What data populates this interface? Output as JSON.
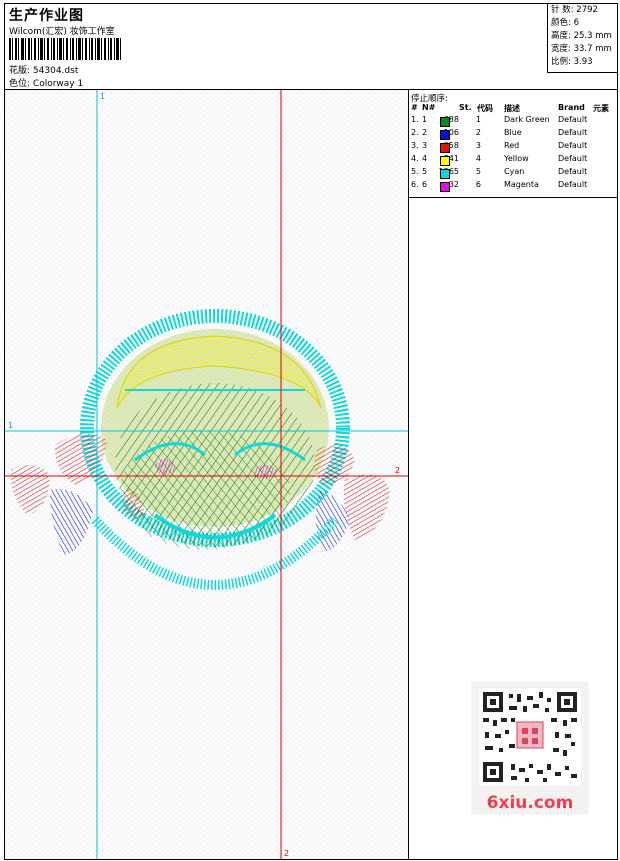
{
  "header": {
    "title": "生产作业图",
    "company": "Wilcom(汇宏) 妆饰工作室",
    "design_label": "花版:",
    "design_value": "54304.dst",
    "colorway_label": "色位:",
    "colorway_value": "Colorway 1"
  },
  "stats": [
    {
      "label": "针 数:",
      "value": "2792"
    },
    {
      "label": "颜色:",
      "value": "6"
    },
    {
      "label": "高度:",
      "value": "25.3 mm"
    },
    {
      "label": "宽度:",
      "value": "33.7 mm"
    },
    {
      "label": "比例:",
      "value": "3.93"
    }
  ],
  "canvas": {
    "guide_h_label_left": "1",
    "guide_h_label_right": "2",
    "guide_v_label_top": "1",
    "guide_v_label_bottom": "2",
    "colors": {
      "cyan_guide": "#00c8d8",
      "red_guide": "#e00000"
    }
  },
  "stop_sequence": {
    "title": "停止顺序:",
    "headers": {
      "num": "#",
      "no": "N#",
      "st": "St.",
      "code": "代码",
      "desc": "描述",
      "brand": "Brand",
      "elem": "元素"
    },
    "rows": [
      {
        "num": "1.",
        "no": "1",
        "color": "#0a8a1e",
        "st": "688",
        "code": "1",
        "desc": "Dark Green",
        "brand": "Default"
      },
      {
        "num": "2.",
        "no": "2",
        "color": "#0014dc",
        "st": "106",
        "code": "2",
        "desc": "Blue",
        "brand": "Default"
      },
      {
        "num": "3.",
        "no": "3",
        "color": "#e01010",
        "st": "358",
        "code": "3",
        "desc": "Red",
        "brand": "Default"
      },
      {
        "num": "4.",
        "no": "4",
        "color": "#ffff00",
        "st": "341",
        "code": "4",
        "desc": "Yellow",
        "brand": "Default"
      },
      {
        "num": "5.",
        "no": "5",
        "color": "#10d8d8",
        "st": "1265",
        "code": "5",
        "desc": "Cyan",
        "brand": "Default"
      },
      {
        "num": "6.",
        "no": "6",
        "color": "#e010e0",
        "st": "32",
        "code": "6",
        "desc": "Magenta",
        "brand": "Default"
      }
    ]
  },
  "watermark": {
    "logo_text": "6xiu.com"
  }
}
